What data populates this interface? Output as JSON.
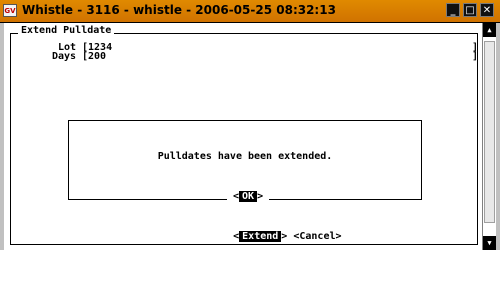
{
  "window": {
    "app_icon_text": "GV",
    "title": "Whistle - 3116 - whistle - 2006-05-25 08:32:13",
    "minimize_glyph": "_",
    "maximize_glyph": "□",
    "close_glyph": "✕"
  },
  "form": {
    "legend": "Extend Pulldate",
    "lot_label": "Lot",
    "lot_value": "[1234",
    "days_label": "Days",
    "days_value": "[200",
    "field_end": "]"
  },
  "dialog": {
    "message": "Pulldates have been extended.",
    "ok_open": "<",
    "ok_label": "OK",
    "ok_close": ">"
  },
  "actions": {
    "extend_open": "<",
    "extend_label": "Extend",
    "extend_close": ">",
    "cancel_label": "<Cancel>"
  },
  "scrollbar": {
    "up_glyph": "▲",
    "down_glyph": "▼"
  },
  "colors": {
    "titlebar": "#d98000",
    "window_bg": "#c0c0c0",
    "terminal_bg": "#ffffff"
  }
}
